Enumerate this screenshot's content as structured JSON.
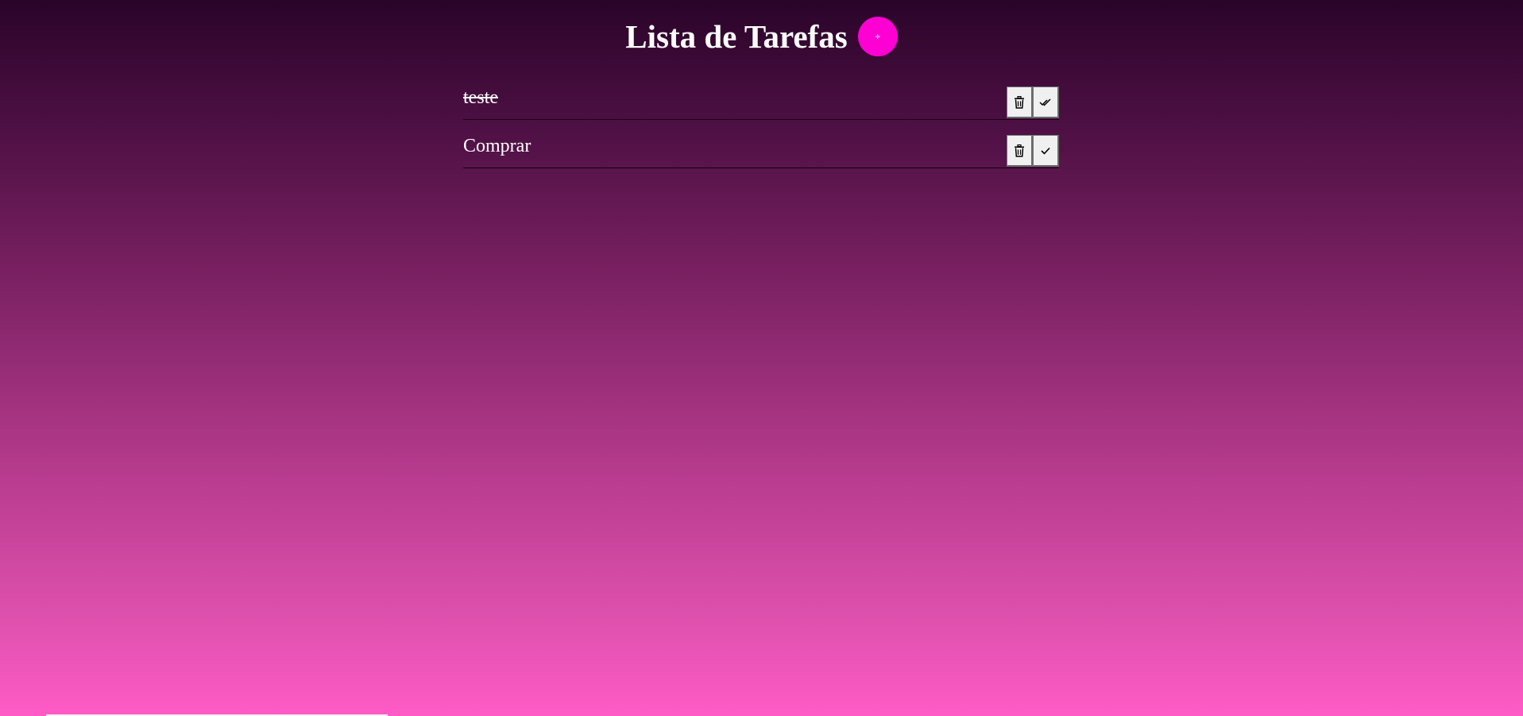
{
  "header": {
    "title": "Lista de Tarefas",
    "add_label": "+"
  },
  "tasks": [
    {
      "text": "teste",
      "done": true,
      "complete_icon": "double-check-icon"
    },
    {
      "text": "Comprar",
      "done": false,
      "complete_icon": "check-icon"
    }
  ],
  "icons": {
    "delete": "trash-icon",
    "add": "plus-icon"
  },
  "colors": {
    "accent": "#ff00d4",
    "gradient_top": "#2a0429",
    "gradient_bottom": "#ff5bc6",
    "text": "#ffffff"
  }
}
